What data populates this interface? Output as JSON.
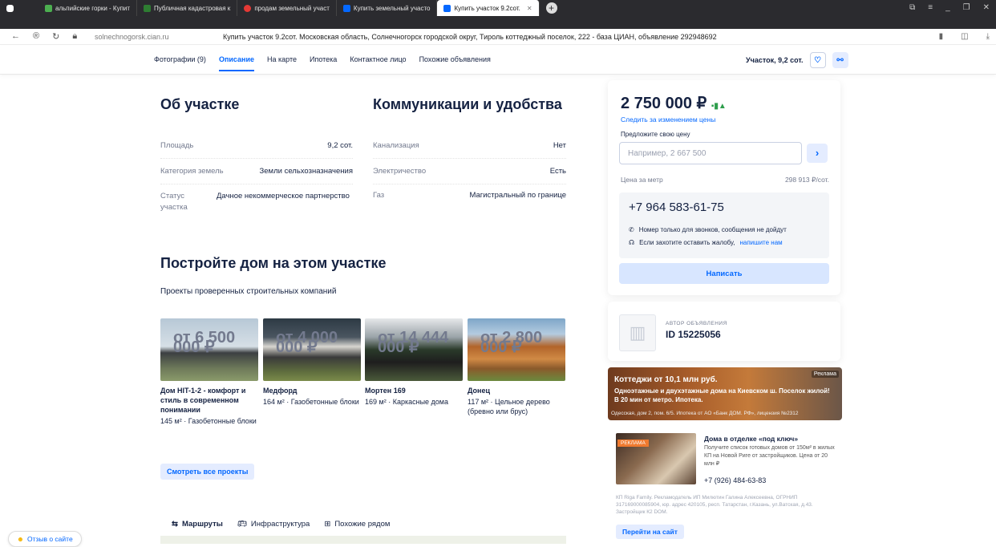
{
  "browser": {
    "tabs": [
      {
        "label": "альпийские горки - Купит",
        "color": "#4caf50",
        "active": false
      },
      {
        "label": "Публичная кадастровая к",
        "color": "#2e7d32",
        "active": false
      },
      {
        "label": "продам земельный участ",
        "color": "#e53935",
        "active": false
      },
      {
        "label": "Купить земельный участо",
        "color": "#0468ff",
        "active": false
      },
      {
        "label": "Купить участок 9.2сот.",
        "color": "#0468ff",
        "active": true
      }
    ],
    "new_tab": "+",
    "domain": "solnechnogorsk.cian.ru",
    "page_title": "Купить участок 9.2сот. Московская область, Солнечногорск городской округ, Тироль коттеджный поселок, 222 - база ЦИАН, объявление 292948692"
  },
  "subnav": {
    "links": [
      "Фотографии (9)",
      "Описание",
      "На карте",
      "Ипотека",
      "Контактное лицо",
      "Похожие объявления"
    ],
    "active": "Описание",
    "summary": "Участок, 9,2 сот."
  },
  "about": {
    "title": "Об участке",
    "rows": [
      {
        "label": "Площадь",
        "value": "9,2 сот."
      },
      {
        "label": "Категория земель",
        "value": "Земли сельхозназначения"
      },
      {
        "label": "Статус участка",
        "value": "Дачное некоммерческое партнерство"
      }
    ]
  },
  "utilities": {
    "title": "Коммуникации и удобства",
    "rows": [
      {
        "label": "Канализация",
        "value": "Нет"
      },
      {
        "label": "Электричество",
        "value": "Есть"
      },
      {
        "label": "Газ",
        "value": "Магистральный по границе"
      }
    ]
  },
  "build": {
    "title": "Постройте дом на этом участке",
    "subtitle": "Проекты проверенных строительных компаний",
    "projects": [
      {
        "name": "Дом HIT-1-2 - комфорт и стиль в современном понимании",
        "price": "от 6 500 000 ₽",
        "desc": "145 м² · Газобетонные блоки"
      },
      {
        "name": "Медфорд",
        "price": "от 4 000 000 ₽",
        "desc": "164 м² · Газобетонные блоки"
      },
      {
        "name": "Мортен 169",
        "price": "от 14 444 000 ₽",
        "desc": "169 м² · Каркасные дома"
      },
      {
        "name": "Донец",
        "price": "от 2 800 000 ₽",
        "desc": "117 м² · Цельное дерево (бревно или брус)"
      }
    ],
    "all_button": "Смотреть все проекты"
  },
  "bottom_tabs": [
    "Маршруты",
    "Инфраструктура",
    "Похожие рядом"
  ],
  "feedback": "Отзыв о сайте",
  "offer": {
    "price": "2 750 000 ₽",
    "follow": "Следить за изменением цены",
    "offer_label": "Предложите свою цену",
    "offer_placeholder": "Например, 2 667 500",
    "price_per_label": "Цена за метр",
    "price_per_value": "298 913 ₽/сот.",
    "phone": "+7 964 583-61-75",
    "note1": "Номер только для звонков, сообщения не дойдут",
    "note2_prefix": "Если захотите оставить жалобу,",
    "note2_link": "напишите нам",
    "write": "Написать"
  },
  "author": {
    "caption": "АВТОР ОБЪЯВЛЕНИЯ",
    "id": "ID 15225056"
  },
  "ad1": {
    "tag": "Реклама",
    "title": "Коттеджи от 10,1 млн руб.",
    "text": "Одноэтажные и двухэтажные дома на Киевском ш. Поселок жилой! В 20 мин от метро. Ипотека.",
    "foot": "Одесская, дом 2, пом. 6/5. Ипотека от АО «Банк ДОМ. РФ», лицензия №2312"
  },
  "ad2": {
    "tag": "РЕКЛАМА",
    "title": "Дома в отделке «под ключ»",
    "text": "Получите список готовых домов от 150м² в жилых КП на Новой Риге от застройщиков. Цена от 20 млн ₽",
    "phone": "+7 (926) 484-63-83",
    "legal": "КП Riga Family. Рекламодатель ИП Милютин Галина Алексеевна, ОГРНИП 317169000085904, юр. адрес 420105, респ. Татарстан, г.Казань, ул.Ватская, д.43. Застройщик К2 DOM.",
    "button": "Перейти на сайт"
  }
}
